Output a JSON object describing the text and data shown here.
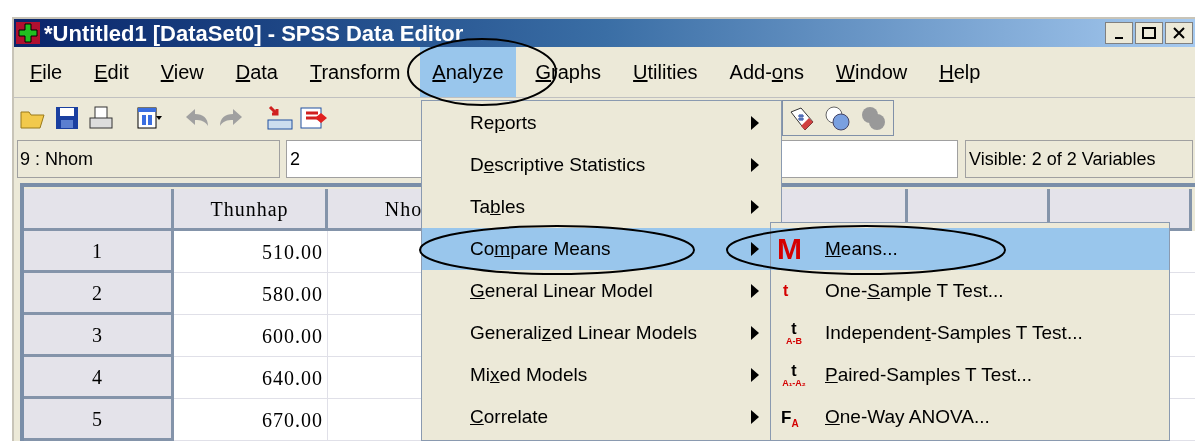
{
  "window": {
    "title": "*Untitled1 [DataSet0] - SPSS Data Editor"
  },
  "menu_bar": [
    {
      "key": "F",
      "after": "ile",
      "selected": false
    },
    {
      "key": "E",
      "after": "dit",
      "selected": false
    },
    {
      "key": "V",
      "after": "iew",
      "selected": false
    },
    {
      "key": "D",
      "after": "ata",
      "selected": false
    },
    {
      "key": "T",
      "after": "ransform",
      "selected": false
    },
    {
      "key": "A",
      "after": "nalyze",
      "selected": true
    },
    {
      "key": "G",
      "after": "raphs",
      "selected": false
    },
    {
      "key": "U",
      "after": "tilities",
      "selected": false
    },
    {
      "before": "Add-",
      "key": "o",
      "after": "ns",
      "selected": false
    },
    {
      "key": "W",
      "after": "indow",
      "selected": false
    },
    {
      "key": "H",
      "after": "elp",
      "selected": false
    }
  ],
  "cell_bar": {
    "cell_name": "9 : Nhom",
    "value": "2",
    "visible": "Visible: 2 of 2 Variables"
  },
  "grid": {
    "columns": [
      "Thunhap",
      "Nho"
    ],
    "rows": [
      {
        "number": "1",
        "values": [
          "510.00"
        ]
      },
      {
        "number": "2",
        "values": [
          "580.00"
        ]
      },
      {
        "number": "3",
        "values": [
          "600.00"
        ]
      },
      {
        "number": "4",
        "values": [
          "640.00"
        ]
      },
      {
        "number": "5",
        "values": [
          "670.00"
        ]
      }
    ]
  },
  "analyze_menu": [
    {
      "before": "Re",
      "key": "p",
      "after": "orts",
      "selected": false
    },
    {
      "before": "D",
      "key": "e",
      "after": "scriptive Statistics",
      "selected": false
    },
    {
      "before": "Ta",
      "key": "b",
      "after": "les",
      "selected": false
    },
    {
      "before": "Co",
      "key": "m",
      "after": "pare Means",
      "selected": true
    },
    {
      "key": "G",
      "after": "eneral Linear Model",
      "selected": false
    },
    {
      "before": "Generali",
      "key": "z",
      "after": "ed Linear Models",
      "selected": false
    },
    {
      "before": "Mi",
      "key": "x",
      "after": "ed Models",
      "selected": false
    },
    {
      "key": "C",
      "after": "orrelate",
      "selected": false
    }
  ],
  "compare_means_menu": [
    {
      "key": "M",
      "after": "eans...",
      "selected": true,
      "icon": {
        "kind": "large",
        "glyph": "M"
      }
    },
    {
      "before": "One-",
      "key": "S",
      "after": "ample T Test...",
      "selected": false,
      "icon": {
        "kind": "small",
        "glyph": "t"
      }
    },
    {
      "before": "Independen",
      "key": "t",
      "after": "-Samples T Test...",
      "selected": false,
      "icon": {
        "kind": "stacked",
        "glyph": "t",
        "sub": "A-B"
      }
    },
    {
      "key": "P",
      "after": "aired-Samples T Test...",
      "selected": false,
      "icon": {
        "kind": "stacked",
        "glyph": "t",
        "sub": "A₁-A₂"
      }
    },
    {
      "key": "O",
      "after": "ne-Way ANOVA...",
      "selected": false,
      "icon": {
        "kind": "subscript",
        "glyph": "F",
        "sub": "A"
      }
    }
  ]
}
